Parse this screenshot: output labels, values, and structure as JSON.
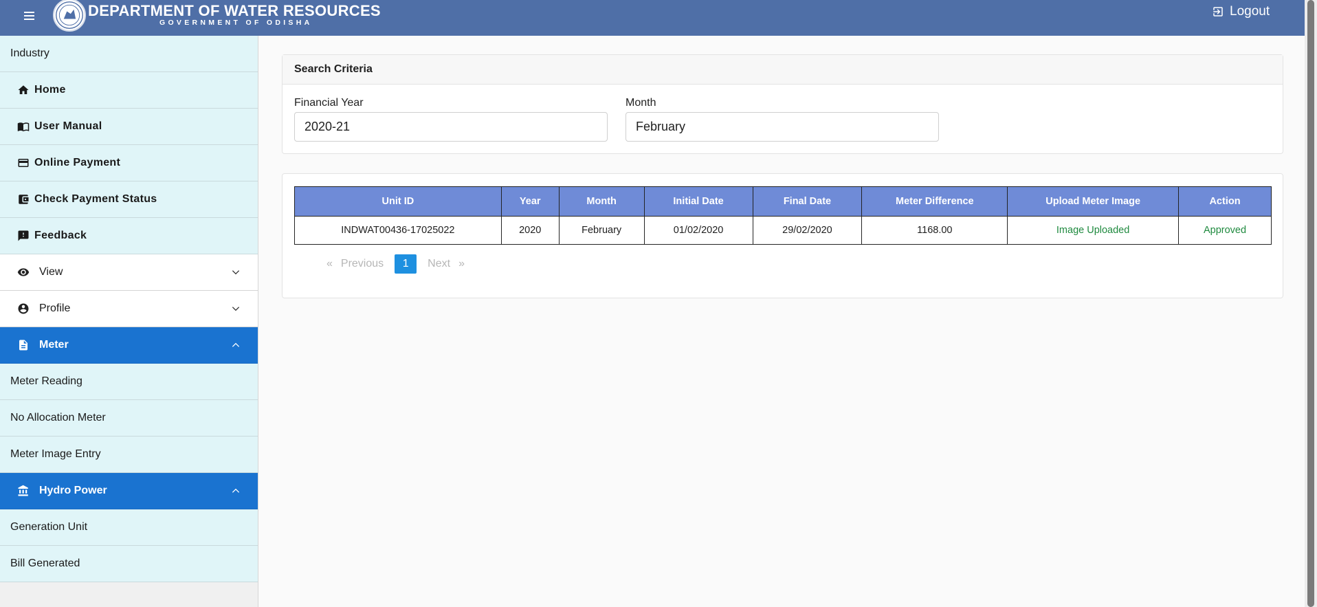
{
  "header": {
    "title": "DEPARTMENT OF WATER RESOURCES",
    "subtitle": "GOVERNMENT OF ODISHA",
    "logout_label": "Logout"
  },
  "sidebar": {
    "section_label": "Industry",
    "items": [
      {
        "label": "Home",
        "icon": "home-icon"
      },
      {
        "label": "User Manual",
        "icon": "book-icon"
      },
      {
        "label": "Online Payment",
        "icon": "credit-card-icon"
      },
      {
        "label": "Check Payment Status",
        "icon": "wallet-icon"
      },
      {
        "label": "Feedback",
        "icon": "feedback-icon"
      }
    ],
    "view_label": "View",
    "profile_label": "Profile",
    "meter_label": "Meter",
    "meter_items": [
      "Meter Reading",
      "No Allocation Meter",
      "Meter Image Entry"
    ],
    "hydro_label": "Hydro Power",
    "hydro_items": [
      "Generation Unit",
      "Bill Generated"
    ]
  },
  "search": {
    "title": "Search Criteria",
    "fy_label": "Financial Year",
    "fy_value": "2020-21",
    "month_label": "Month",
    "month_value": "February"
  },
  "table": {
    "columns": [
      "Unit ID",
      "Year",
      "Month",
      "Initial Date",
      "Final Date",
      "Meter Difference",
      "Upload Meter Image",
      "Action"
    ],
    "rows": [
      [
        "INDWAT00436-17025022",
        "2020",
        "February",
        "01/02/2020",
        "29/02/2020",
        "1168.00",
        "Image Uploaded",
        "Approved"
      ]
    ]
  },
  "pagination": {
    "first": "«",
    "previous": "Previous",
    "current": "1",
    "next": "Next",
    "last": "»"
  },
  "colors": {
    "header": "#4f6fa7",
    "sidebar_item": "#e0f5f8",
    "active": "#1a73d0",
    "table_head": "#6f8bd7",
    "status_green": "#1f8a3f"
  }
}
